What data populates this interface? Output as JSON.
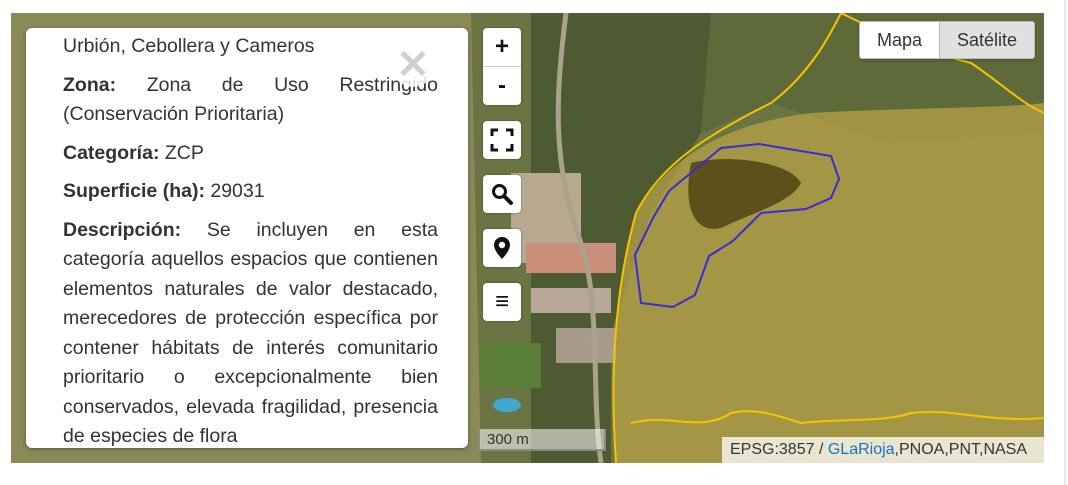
{
  "popup": {
    "title_line": "Urbión, Cebollera y Cameros",
    "fields": [
      {
        "label": "Zona:",
        "value": "Zona de Uso Restringido (Conservación Prioritaria)"
      },
      {
        "label": "Categoría:",
        "value": "ZCP"
      },
      {
        "label": "Superficie (ha):",
        "value": "29031"
      },
      {
        "label": "Descripción:",
        "value": "Se incluyen en esta categoría aquellos espacios que contienen elementos naturales de valor destacado, merecedores de protección específica por contener hábitats de interés comunitario prioritario o excepcionalmente bien conservados, elevada fragilidad, presencia de especies de flora"
      }
    ],
    "close_symbol": "✕"
  },
  "controls": {
    "zoom_in": "+",
    "zoom_out": "-",
    "fullscreen_icon": "fullscreen-icon",
    "search_icon": "search-icon",
    "location_icon": "map-pin-icon",
    "menu_symbol": "≡"
  },
  "layers": {
    "map_label": "Mapa",
    "satellite_label": "Satélite",
    "active": "Mapa"
  },
  "scale": {
    "label": "300 m"
  },
  "attribution": {
    "prefix": "EPSG:3857 / ",
    "link": "GLaRioja",
    "suffix": ",PNOA,PNT,NASA"
  },
  "colors": {
    "zone_boundary": "#f5c400",
    "selected_boundary": "#3a2ad8",
    "link": "#1a73b8"
  }
}
